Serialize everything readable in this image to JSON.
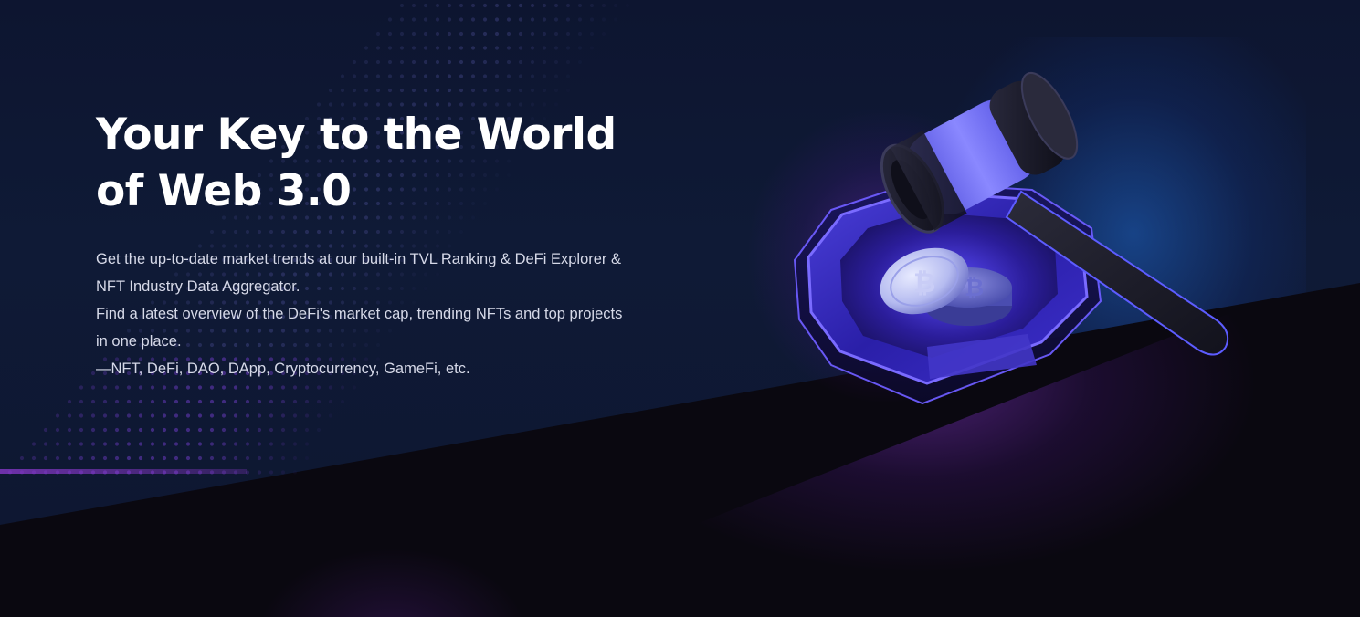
{
  "hero": {
    "headline": "Your Key to the World of Web 3.0",
    "description_lines": [
      "Get the up-to-date market trends at our built-in TVL Ranking & DeFi Explorer & NFT Industry Data Aggregator.",
      "Find a latest overview of the DeFi's market cap, trending NFTs and top projects in one place.",
      "—NFT, DeFi, DAO, DApp, Cryptocurrency, GameFi, etc."
    ]
  },
  "illustration": {
    "icon": "gavel-coins-illustration"
  },
  "colors": {
    "background": "#0f1a36",
    "floor": "#0a0810",
    "accent_purple": "#7b3fe4",
    "accent_blue": "#4b5cf0",
    "headline": "#ffffff",
    "body_text": "#d6d9e8"
  }
}
